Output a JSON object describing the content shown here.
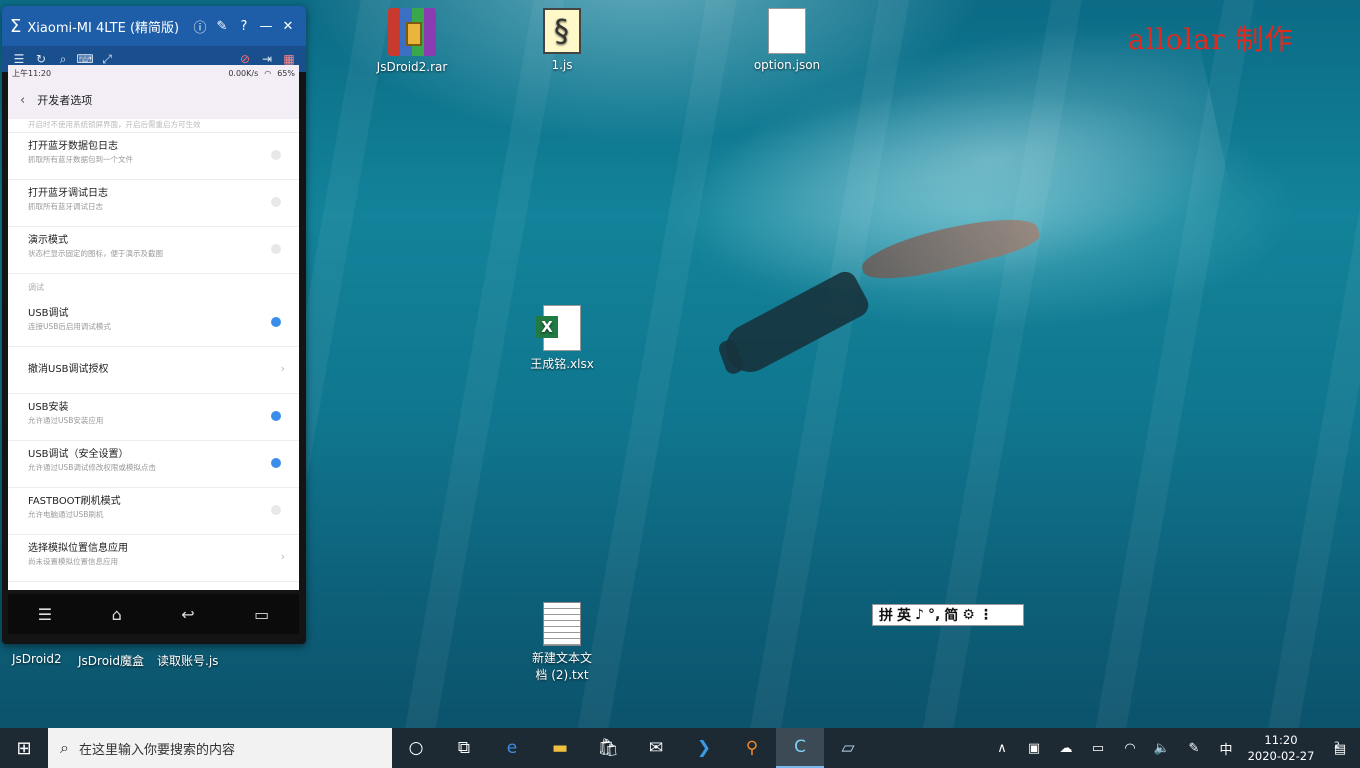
{
  "watermark": "allolar  制作",
  "desktop_icons": [
    {
      "label": "JsDroid2.rar",
      "icon": "winrar-archive-icon"
    },
    {
      "label": "1.js",
      "icon": "js-script-icon"
    },
    {
      "label": "option.json",
      "icon": "json-file-icon"
    },
    {
      "label": "王成铭.xlsx",
      "icon": "excel-file-icon"
    },
    {
      "label": "新建文本文档 (2).txt",
      "icon": "text-file-icon"
    }
  ],
  "below_phone_icons": [
    "JsDroid2",
    "JsDroid魔盒",
    "读取账号.js"
  ],
  "phone_window": {
    "title": "Xiaomi-MI 4LTE (精简版)",
    "statusbar": {
      "time": "上午11:20",
      "speed": "0.00K/s",
      "battery": "65%"
    },
    "appbar_title": "开发者选项",
    "partial_top": "开启时不使用系统锁屏界面，开启后需重启方可生效",
    "rows_a": [
      {
        "title": "打开蓝牙数据包日志",
        "subtitle": "抓取所有蓝牙数据包到一个文件",
        "toggle": "off"
      },
      {
        "title": "打开蓝牙调试日志",
        "subtitle": "抓取所有蓝牙调试日志",
        "toggle": "off"
      },
      {
        "title": "演示模式",
        "subtitle": "状态栏显示固定的图标，便于演示及截图",
        "toggle": "off"
      }
    ],
    "section": "调试",
    "rows_b": [
      {
        "title": "USB调试",
        "subtitle": "连接USB后启用调试模式",
        "toggle": "on"
      },
      {
        "title": "撤消USB调试授权",
        "subtitle": "",
        "toggle": "chevron"
      },
      {
        "title": "USB安装",
        "subtitle": "允许通过USB安装应用",
        "toggle": "on"
      },
      {
        "title": "USB调试（安全设置）",
        "subtitle": "允许通过USB调试修改权限或模拟点击",
        "toggle": "on"
      },
      {
        "title": "FASTBOOT刷机模式",
        "subtitle": "允许电脑通过USB刷机",
        "toggle": "off"
      },
      {
        "title": "选择模拟位置信息应用",
        "subtitle": "尚未设置模拟位置信息应用",
        "toggle": "chevron"
      }
    ]
  },
  "ime": {
    "items": [
      "拼",
      "英",
      "♪",
      "°,",
      "简",
      "⚙",
      "⋮"
    ]
  },
  "taskbar": {
    "search_placeholder": "在这里输入你要搜索的内容",
    "time": "11:20",
    "date": "2020-02-27",
    "ime_lang": "中",
    "notifications": "2"
  }
}
